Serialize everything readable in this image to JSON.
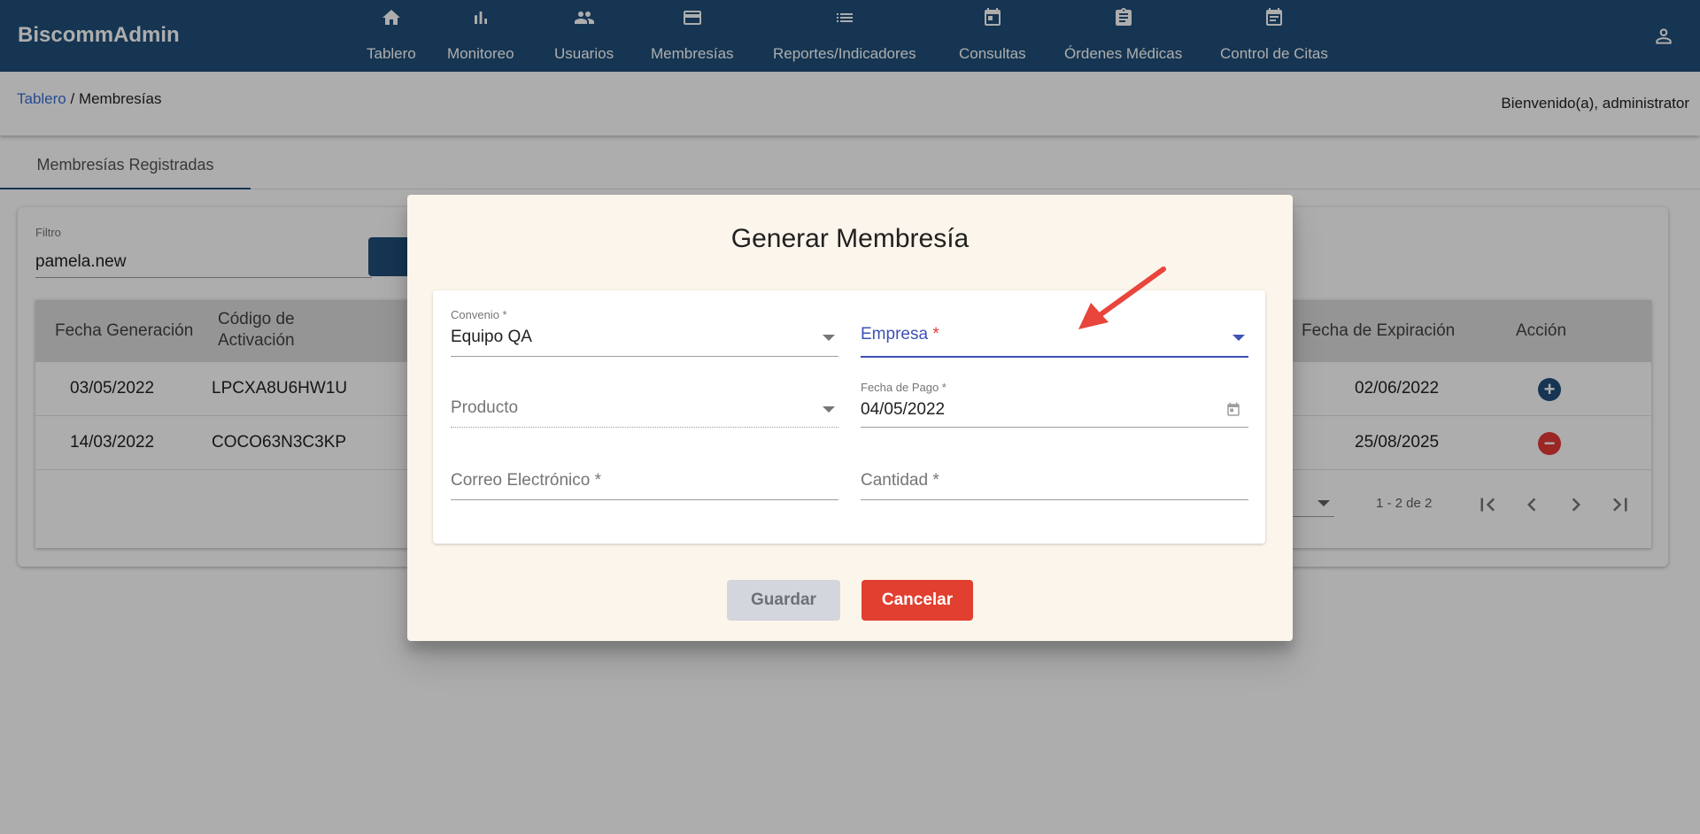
{
  "app": {
    "brand": "BiscommAdmin"
  },
  "nav": {
    "items": [
      {
        "label": "Tablero",
        "icon": "home-icon"
      },
      {
        "label": "Monitoreo",
        "icon": "bar-chart-icon"
      },
      {
        "label": "Usuarios",
        "icon": "people-icon"
      },
      {
        "label": "Membresías",
        "icon": "credit-card-icon"
      },
      {
        "label": "Reportes/Indicadores",
        "icon": "list-icon"
      },
      {
        "label": "Consultas",
        "icon": "calendar-icon"
      },
      {
        "label": "Órdenes Médicas",
        "icon": "clipboard-icon"
      },
      {
        "label": "Control de Citas",
        "icon": "calendar-icon"
      }
    ]
  },
  "breadcrumb": {
    "root": "Tablero",
    "separator": " / ",
    "current": "Membresías"
  },
  "welcome": "Bienvenido(a), administrator",
  "tabs": {
    "active": "Membresías Registradas"
  },
  "filter": {
    "label": "Filtro",
    "value": "pamela.new"
  },
  "table": {
    "headers": {
      "fecha_generacion": "Fecha Generación",
      "codigo": "Código de Activación",
      "fecha_expiracion": "Fecha de Expiración",
      "accion": "Acción"
    },
    "rows": [
      {
        "fecha_generacion": "03/05/2022",
        "codigo": "LPCXA8U6HW1U",
        "fecha_expiracion": "02/06/2022",
        "accion": "add"
      },
      {
        "fecha_generacion": "14/03/2022",
        "codigo": "COCO63N3C3KP",
        "fecha_expiracion": "25/08/2025",
        "accion": "remove"
      }
    ],
    "paginator": {
      "range": "1 - 2 de 2"
    }
  },
  "dialog": {
    "title": "Generar Membresía",
    "convenio": {
      "label": "Convenio *",
      "value": "Equipo QA"
    },
    "empresa": {
      "label": "Empresa",
      "required_mark": "*"
    },
    "producto": {
      "placeholder": "Producto"
    },
    "fecha_pago": {
      "label": "Fecha de Pago *",
      "value": "04/05/2022"
    },
    "correo": {
      "placeholder": "Correo Electrónico *"
    },
    "cantidad": {
      "placeholder": "Cantidad *"
    },
    "save_label": "Guardar",
    "cancel_label": "Cancelar"
  },
  "colors": {
    "primary": "#1f4e79",
    "accent": "#3f51b5",
    "danger": "#e13f2f",
    "dialog_bg": "#fcf5eb",
    "annotation_arrow": "#e8453c"
  }
}
